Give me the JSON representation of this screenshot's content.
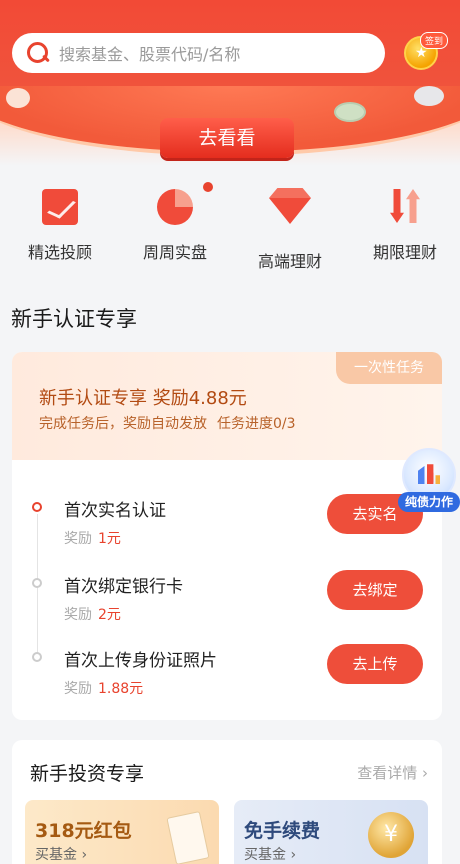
{
  "search": {
    "placeholder": "搜索基金、股票代码/名称"
  },
  "signin": {
    "badge": "签到"
  },
  "banner": {
    "cta": "去看看"
  },
  "nav": [
    {
      "label": "精选投顾",
      "icon": "trend-chart-icon"
    },
    {
      "label": "周周实盘",
      "icon": "pie-chart-icon",
      "has_dot": true
    },
    {
      "label": "高端理财",
      "icon": "diamond-icon"
    },
    {
      "label": "期限理财",
      "icon": "updown-arrows-icon"
    }
  ],
  "section_title": "新手认证专享",
  "task_card": {
    "tag": "一次性任务",
    "title": "新手认证专享 奖励4.88元",
    "subtitle": "完成任务后，奖励自动发放",
    "progress": "任务进度0/3",
    "reward_label": "奖励",
    "tasks": [
      {
        "name": "首次实名认证",
        "reward": "1元",
        "button": "去实名",
        "active": true
      },
      {
        "name": "首次绑定银行卡",
        "reward": "2元",
        "button": "去绑定",
        "active": false
      },
      {
        "name": "首次上传身份证照片",
        "reward": "1.88元",
        "button": "去上传",
        "active": false
      }
    ]
  },
  "floating_badge": {
    "label": "纯债力作"
  },
  "invest_card": {
    "title": "新手投资专享",
    "more": "查看详情",
    "promos": [
      {
        "title": "318元红包",
        "sub": "买基金"
      },
      {
        "title": "免手续费",
        "sub": "买基金"
      }
    ]
  },
  "colors": {
    "accent": "#e8432e",
    "header": "#f24a36"
  }
}
